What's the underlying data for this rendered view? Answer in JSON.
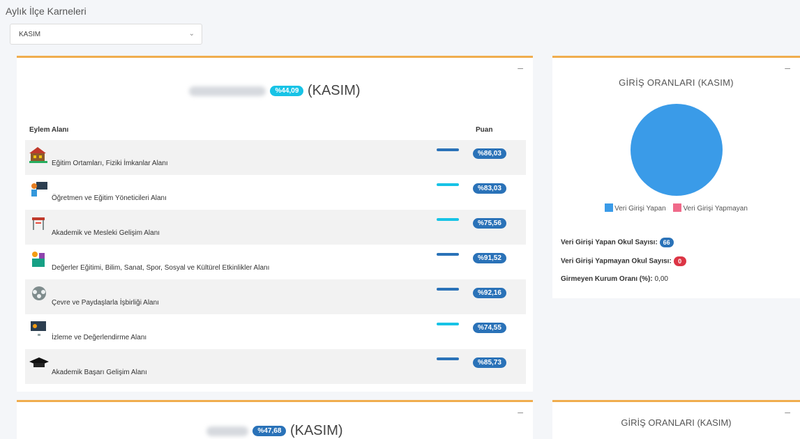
{
  "page": {
    "title": "Aylık İlçe Karneleri"
  },
  "filter": {
    "selected": "KASIM"
  },
  "colors": {
    "accent": "#f0ad4e",
    "score_pill": "#2a72b8",
    "percent_pill": "#17c3e6",
    "pie_entered": "#3a9be8",
    "pie_not_entered": "#f06a8a"
  },
  "card1": {
    "overall_percent": "%44,09",
    "period": "(KASIM)",
    "col_area": "Eylem Alanı",
    "col_score": "Puan",
    "rows": [
      {
        "label": "Eğitim Ortamları, Fiziki İmkanlar Alanı",
        "score": "%86,03",
        "icon": "school-building-icon",
        "bar_color": "#2a72b8"
      },
      {
        "label": "Öğretmen ve Eğitim Yöneticileri Alanı",
        "score": "%83,03",
        "icon": "teacher-icon",
        "bar_color": "#17c3e6"
      },
      {
        "label": "Akademik ve Mesleki Gelişim Alanı",
        "score": "%75,56",
        "icon": "classroom-icon",
        "bar_color": "#17c3e6"
      },
      {
        "label": "Değerler Eğitimi, Bilim, Sanat, Spor, Sosyal ve Kültürel Etkinlikler Alanı",
        "score": "%91,52",
        "icon": "activities-icon",
        "bar_color": "#2a72b8"
      },
      {
        "label": "Çevre ve Paydaşlarla İşbirliği Alanı",
        "score": "%92,16",
        "icon": "collaboration-icon",
        "bar_color": "#2a72b8"
      },
      {
        "label": "İzleme ve Değerlendirme Alanı",
        "score": "%74,55",
        "icon": "monitor-icon",
        "bar_color": "#17c3e6"
      },
      {
        "label": "Akademik Başarı Gelişim Alanı",
        "score": "%85,73",
        "icon": "graduation-cap-icon",
        "bar_color": "#2a72b8"
      }
    ]
  },
  "side1": {
    "title": "GİRİŞ ORANLARI (KASIM)",
    "legend_entered": "Veri Girişi Yapan",
    "legend_not_entered": "Veri Girişi Yapmayan",
    "entered_label": "Veri Girişi Yapan Okul Sayısı:",
    "entered_count": "66",
    "not_entered_label": "Veri Girişi Yapmayan Okul Sayısı:",
    "not_entered_count": "0",
    "rate_label": "Girmeyen Kurum Oranı (%):",
    "rate_value": "0,00"
  },
  "card2": {
    "overall_percent": "%47,68",
    "period": "(KASIM)"
  },
  "side2": {
    "title": "GİRİŞ ORANLARI (KASIM)"
  }
}
